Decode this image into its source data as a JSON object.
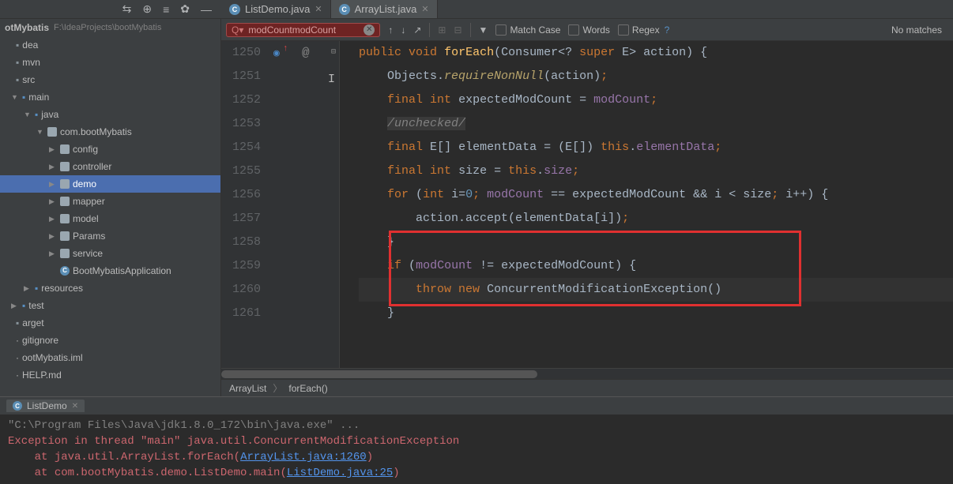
{
  "project": {
    "name": "otMybatis",
    "path": "F:\\IdeaProjects\\bootMybatis"
  },
  "tree": {
    "items": [
      {
        "label": "dea",
        "indent": 0,
        "icon": "folder"
      },
      {
        "label": "mvn",
        "indent": 0,
        "icon": "folder"
      },
      {
        "label": "src",
        "indent": 0,
        "icon": "folder"
      },
      {
        "label": "main",
        "indent": 1,
        "icon": "folder-blue",
        "arrow": "▼"
      },
      {
        "label": "java",
        "indent": 2,
        "icon": "folder-blue",
        "arrow": "▼"
      },
      {
        "label": "com.bootMybatis",
        "indent": 3,
        "icon": "pkg",
        "arrow": "▼"
      },
      {
        "label": "config",
        "indent": 4,
        "icon": "pkg",
        "arrow": "▶"
      },
      {
        "label": "controller",
        "indent": 4,
        "icon": "pkg",
        "arrow": "▶"
      },
      {
        "label": "demo",
        "indent": 4,
        "icon": "pkg",
        "arrow": "▶",
        "selected": true
      },
      {
        "label": "mapper",
        "indent": 4,
        "icon": "pkg",
        "arrow": "▶"
      },
      {
        "label": "model",
        "indent": 4,
        "icon": "pkg",
        "arrow": "▶"
      },
      {
        "label": "Params",
        "indent": 4,
        "icon": "pkg",
        "arrow": "▶"
      },
      {
        "label": "service",
        "indent": 4,
        "icon": "pkg",
        "arrow": "▶"
      },
      {
        "label": "BootMybatisApplication",
        "indent": 4,
        "icon": "class"
      },
      {
        "label": "resources",
        "indent": 2,
        "icon": "folder-blue",
        "arrow": "▶"
      },
      {
        "label": "test",
        "indent": 1,
        "icon": "folder-blue",
        "arrow": "▶"
      },
      {
        "label": "arget",
        "indent": 0,
        "icon": "folder"
      },
      {
        "label": "gitignore",
        "indent": 0,
        "icon": "file"
      },
      {
        "label": "ootMybatis.iml",
        "indent": 0,
        "icon": "file"
      },
      {
        "label": "HELP.md",
        "indent": 0,
        "icon": "file"
      }
    ]
  },
  "tabs": [
    {
      "label": "ListDemo.java",
      "active": false
    },
    {
      "label": "ArrayList.java",
      "active": true
    }
  ],
  "search": {
    "query": "modCountmodCount",
    "match_case": "Match Case",
    "words": "Words",
    "regex": "Regex",
    "no_matches": "No matches"
  },
  "gutter_lines": [
    "1250",
    "1251",
    "1252",
    "1253",
    "1254",
    "1255",
    "1256",
    "1257",
    "1258",
    "1259",
    "1260",
    "1261"
  ],
  "code_tokens": {
    "public": "public",
    "void": "void",
    "forEach": "forEach",
    "consumer": "Consumer",
    "super": "super",
    "action": "action",
    "objects": "Objects",
    "requireNonNull": "requireNonNull",
    "final": "final",
    "int": "int",
    "expectedModCount": "expectedModCount",
    "modCount": "modCount",
    "unchecked": "/unchecked/",
    "elementData": "elementData",
    "this": "this",
    "size": "size",
    "for": "for",
    "i": "i",
    "accept": "accept",
    "if": "if",
    "throw": "throw",
    "new": "new",
    "cme": "ConcurrentModificationException",
    "E": "E"
  },
  "breadcrumb": {
    "class": "ArrayList",
    "method": "forEach()"
  },
  "console": {
    "tab": "ListDemo",
    "cmd": "\"C:\\Program Files\\Java\\jdk1.8.0_172\\bin\\java.exe\" ...",
    "line1": "Exception in thread \"main\" java.util.ConcurrentModificationException",
    "line2a": "at java.util.ArrayList.forEach(",
    "line2link": "ArrayList.java:1260",
    "line2b": ")",
    "line3a": "at com.bootMybatis.demo.ListDemo.main(",
    "line3link": "ListDemo.java:25",
    "line3b": ")"
  }
}
